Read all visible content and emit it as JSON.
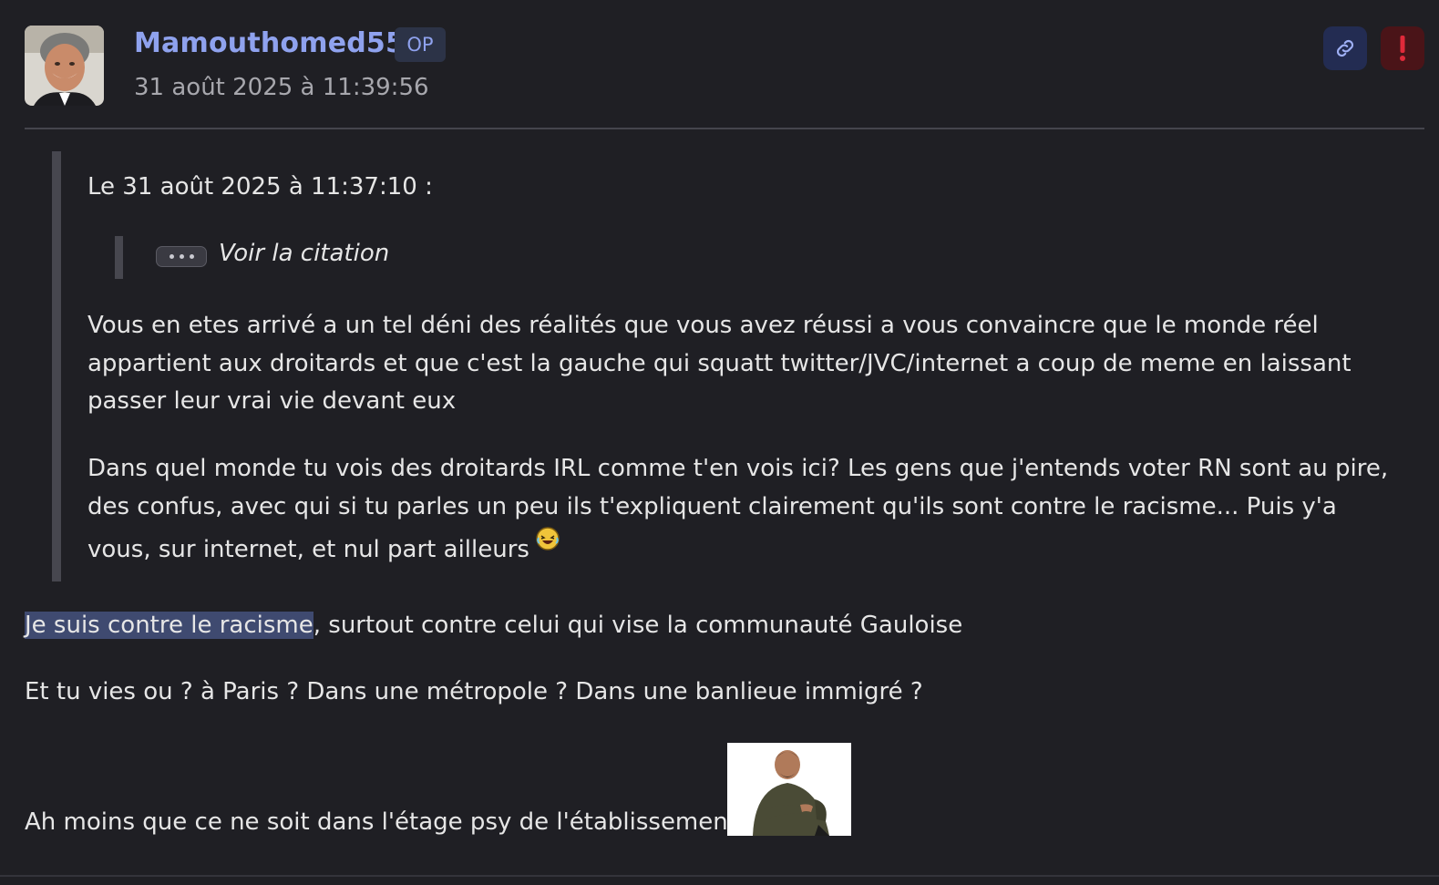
{
  "post": {
    "username": "Mamouthomed55",
    "op_badge": "OP",
    "timestamp": "31 août 2025 à 11:39:56"
  },
  "actions": {
    "link_icon": "link-icon",
    "report_icon": "exclamation-icon"
  },
  "quote": {
    "header": "Le 31 août 2025 à 11:37:10 :",
    "nested_toggle_label": "Voir la citation",
    "paragraph1": "Vous en etes arrivé a un tel déni des réalités que vous avez réussi a vous convaincre que le monde réel appartient aux droitards et que c'est la gauche qui squatt twitter/JVC/internet a coup de meme en laissant passer leur vrai vie devant eux",
    "paragraph2": "Dans quel monde tu vois des droitards IRL comme t'en vois ici? Les gens que j'entends voter RN sont au pire, des confus, avec qui si tu parles un peu ils t'expliquent clairement qu'ils sont contre le racisme... Puis y'a vous, sur internet, et nul part ailleurs"
  },
  "body": {
    "line1_highlight": "Je suis contre le racisme",
    "line1_rest": ", surtout contre celui qui vise la communauté Gauloise",
    "line2": "Et tu vies ou ? à Paris ? Dans une métropole ? Dans une banlieue immigré ?",
    "line3": "Ah moins que ce ne soit dans l'étage psy de l'établissement"
  },
  "colors": {
    "background": "#1f1f24",
    "username": "#8fa2ee",
    "highlight": "#3f4a70",
    "report": "#e02a3a"
  }
}
